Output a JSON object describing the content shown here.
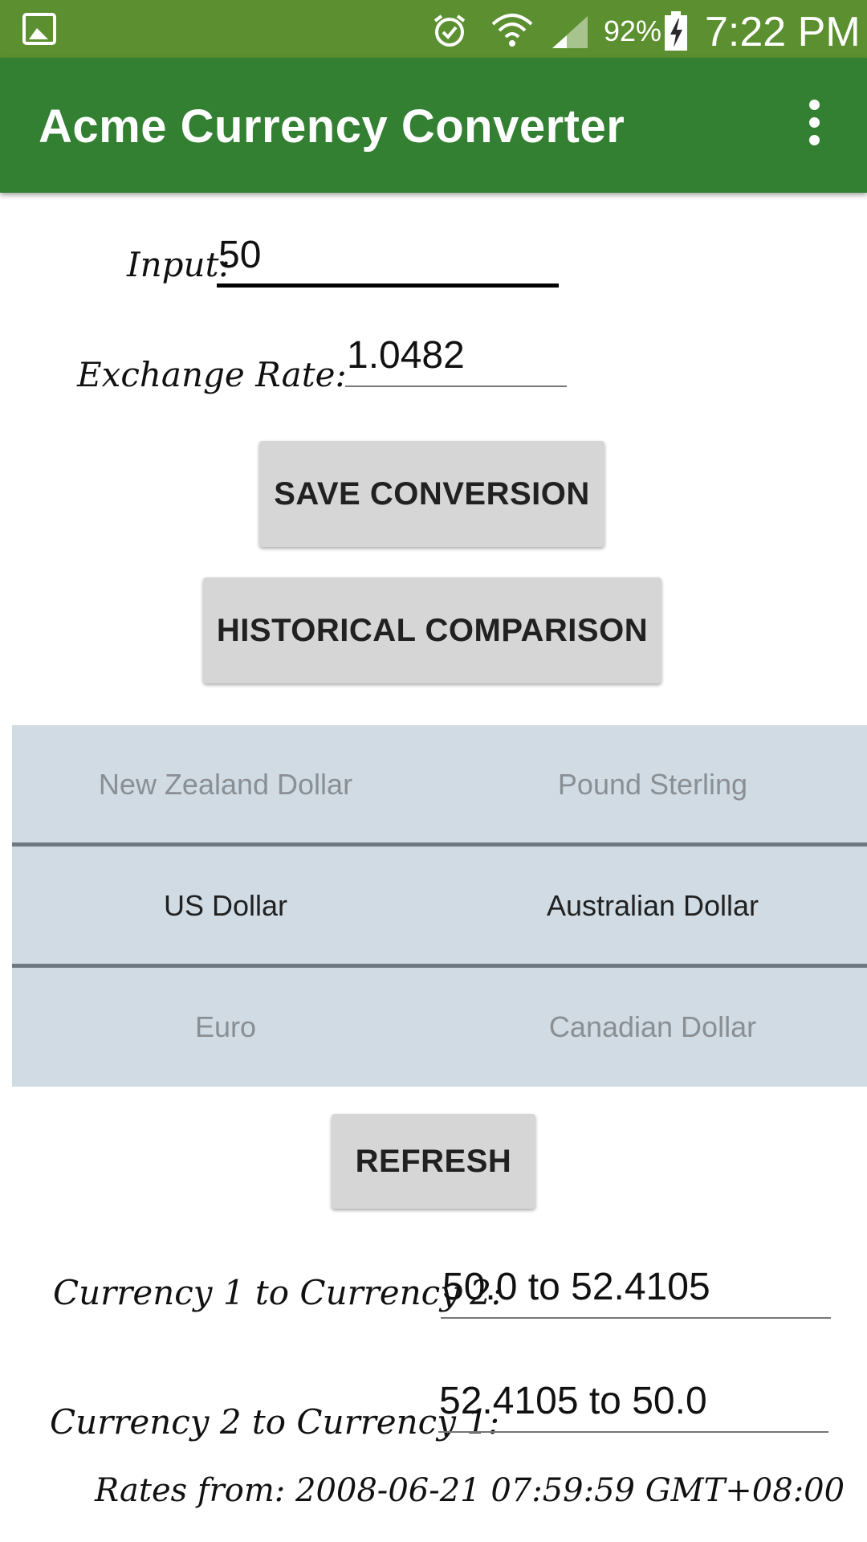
{
  "status_bar": {
    "battery_percent": "92%",
    "time": "7:22 PM",
    "icons": [
      "gallery-icon",
      "alarm-icon",
      "wifi-icon",
      "signal-icon",
      "battery-charging-icon"
    ]
  },
  "app_bar": {
    "title": "Acme Currency Converter",
    "overflow_icon": "more-vert-icon"
  },
  "form": {
    "input_label": "Input:",
    "input_value": "50",
    "rate_label": "Exchange Rate:",
    "rate_value": "1.0482"
  },
  "buttons": {
    "save": "SAVE CONVERSION",
    "historical": "HISTORICAL COMPARISON",
    "refresh": "REFRESH"
  },
  "picker": {
    "left": [
      "New Zealand Dollar",
      "US Dollar",
      "Euro"
    ],
    "right": [
      "Pound Sterling",
      "Australian Dollar",
      "Canadian Dollar"
    ],
    "selected_left": "US Dollar",
    "selected_right": "Australian Dollar"
  },
  "results": {
    "c1_to_c2_label": "Currency 1 to Currency 2:",
    "c1_to_c2_value": "50.0 to 52.4105",
    "c2_to_c1_label": "Currency 2 to Currency 1:",
    "c2_to_c1_value": "52.4105 to 50.0",
    "rates_from": "Rates from: 2008-06-21 07:59:59 GMT+08:00"
  },
  "colors": {
    "status_bar": "#5b8f2f",
    "app_bar": "#338033",
    "picker_bg": "#d0dbe3",
    "button_bg": "#d6d6d6"
  }
}
